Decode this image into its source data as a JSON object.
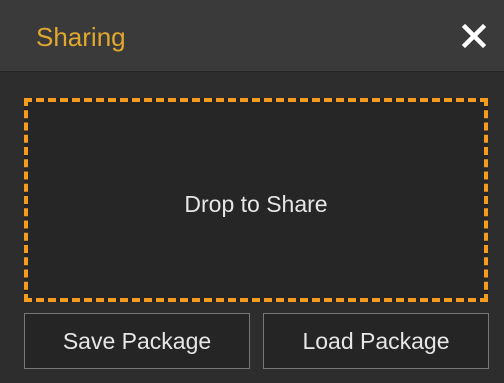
{
  "window": {
    "title": "Sharing",
    "close_icon": "close-icon"
  },
  "dropzone": {
    "label": "Drop to Share"
  },
  "actions": {
    "save_label": "Save Package",
    "load_label": "Load Package"
  },
  "colors": {
    "accent": "#f59b1e",
    "title": "#e0a82e",
    "background": "#2d2d2d",
    "header": "#3a3a3a",
    "text": "#e6e6e6"
  }
}
